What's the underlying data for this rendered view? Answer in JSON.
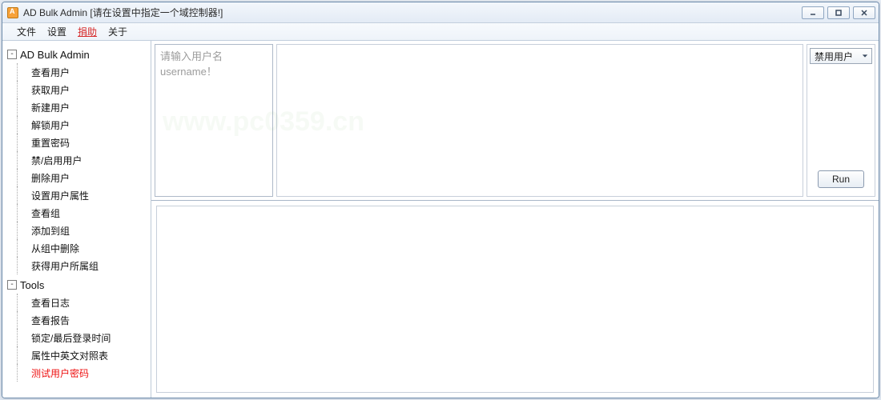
{
  "window": {
    "title": "AD Bulk Admin  [请在设置中指定一个域控制器!]"
  },
  "menubar": {
    "file": "文件",
    "settings": "设置",
    "help": "捐助",
    "about": "关于"
  },
  "tree": {
    "root1_label": "AD Bulk Admin",
    "root1_expander": "-",
    "root1_items": [
      "查看用户",
      "获取用户",
      "新建用户",
      "解锁用户",
      "重置密码",
      "禁/启用用户",
      "删除用户",
      "设置用户属性",
      "查看组",
      "添加到组",
      "从组中删除",
      "获得用户所属组"
    ],
    "root2_label": "Tools",
    "root2_expander": "-",
    "root2_items": [
      "查看日志",
      "查看报告",
      "锁定/最后登录时间",
      "属性中英文对照表",
      "测试用户密码"
    ],
    "active_index": 4
  },
  "panel": {
    "placeholder": "请输入用户名\nusername！",
    "combo_value": "禁用用户",
    "run_label": "Run"
  }
}
